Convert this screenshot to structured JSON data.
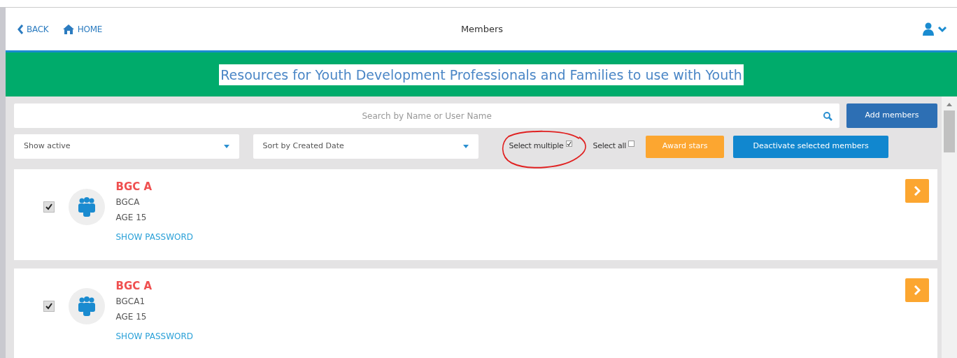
{
  "nav": {
    "back": "BACK",
    "home": "HOME",
    "title": "Members"
  },
  "banner": {
    "text": "Resources for Youth Development Professionals and Families to use with Youth",
    "selected": true
  },
  "search": {
    "placeholder": "Search by Name or User Name"
  },
  "add_button": "Add members",
  "filters": [
    {
      "value": "Show active"
    },
    {
      "value": "Sort by Created Date"
    }
  ],
  "toggles": [
    {
      "label": "Select multiple",
      "checked": true
    },
    {
      "label": "Select all",
      "checked": false
    }
  ],
  "actions": [
    {
      "label": "Award stars",
      "kind": "warning"
    },
    {
      "label": "Deactivate selected members",
      "kind": "info"
    }
  ],
  "members": [
    {
      "name": "BGC A",
      "username": "BGCA",
      "age": "AGE 15",
      "link": "SHOW PASSWORD",
      "checked": true
    },
    {
      "name": "BGC A",
      "username": "BGCA1",
      "age": "AGE 15",
      "link": "SHOW PASSWORD",
      "checked": true
    }
  ]
}
